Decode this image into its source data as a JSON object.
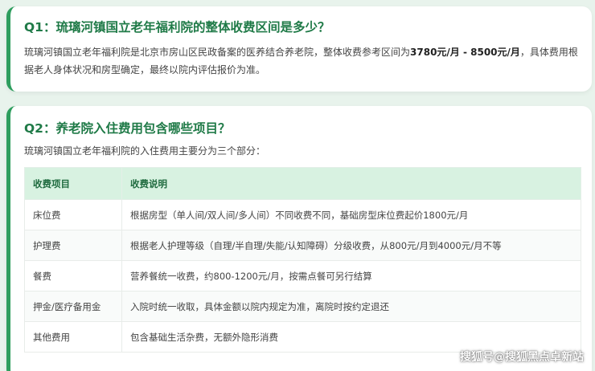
{
  "q1": {
    "title": "Q1：琉璃河镇国立老年福利院的整体收费区间是多少？",
    "answer_pre": "琉璃河镇国立老年福利院是北京市房山区民政备案的医养结合养老院，整体收费参考区间为",
    "answer_bold": "3780元/月 - 8500元/月",
    "answer_post": "，具体费用根据老人身体状况和房型确定，最终以院内评估报价为准。"
  },
  "q2": {
    "title": "Q2：养老院入住费用包含哪些项目？",
    "intro": "琉璃河镇国立老年福利院的入住费用主要分为三个部分：",
    "table": {
      "headers": [
        "收费项目",
        "收费说明"
      ],
      "rows": [
        [
          "床位费",
          "根据房型（单人间/双人间/多人间）不同收费不同，基础房型床位费起价1800元/月"
        ],
        [
          "护理费",
          "根据老人护理等级（自理/半自理/失能/认知障碍）分级收费，从800元/月到4000元/月不等"
        ],
        [
          "餐费",
          "营养餐统一收费，约800-1200元/月，按需点餐可另行结算"
        ],
        [
          "押金/医疗备用金",
          "入院时统一收取，具体金额以院内规定为准，离院时按约定退还"
        ],
        [
          "其他费用",
          "包含基础生活杂费，无额外隐形消费"
        ]
      ]
    }
  },
  "watermark": "搜狐号@搜狐黑点卓新站"
}
